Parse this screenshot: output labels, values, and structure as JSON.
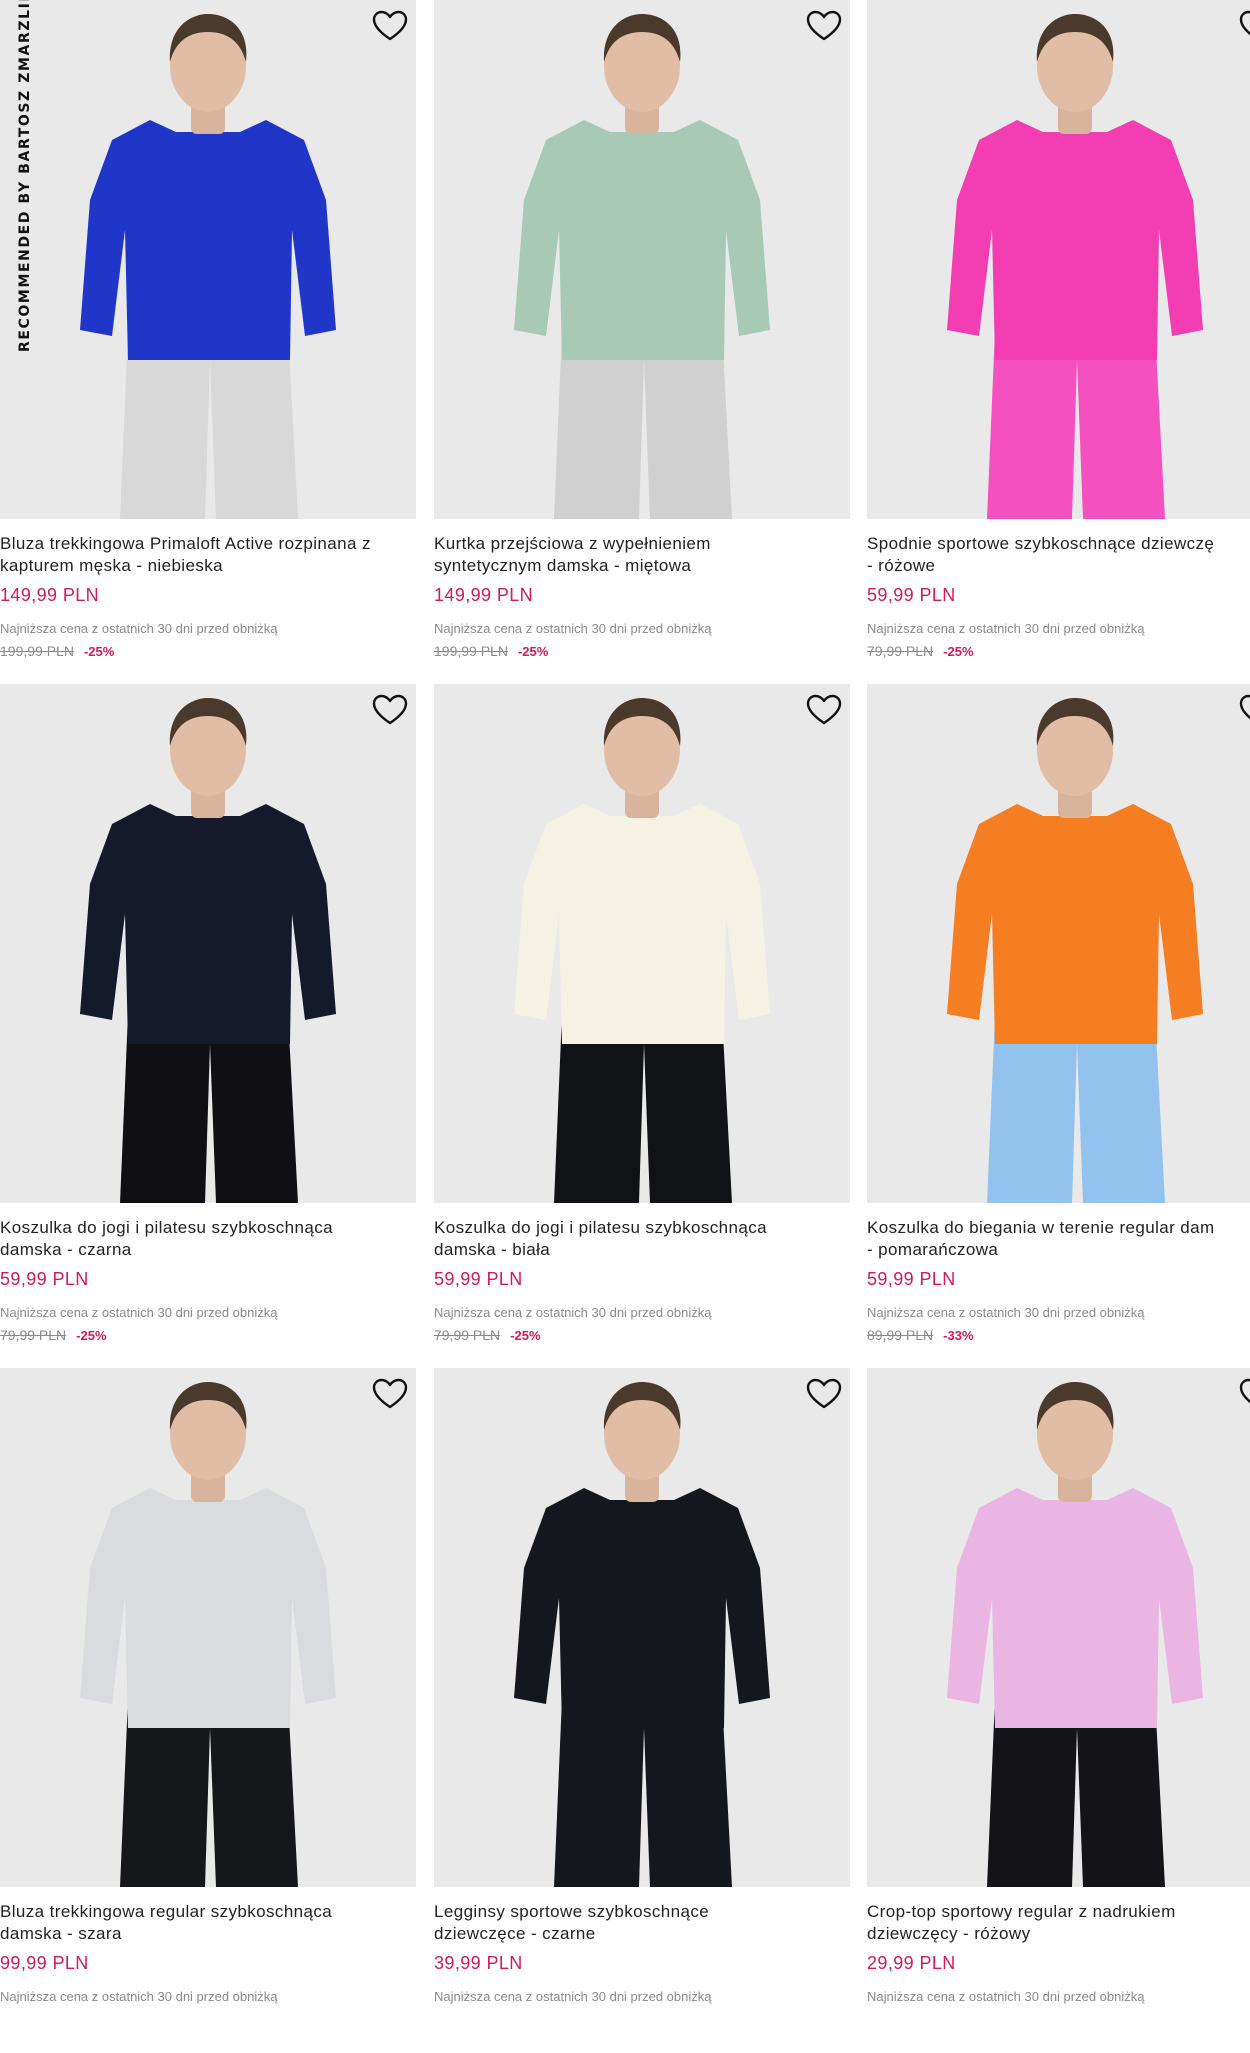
{
  "side_label": "RECOMMENDED BY BARTOSZ ZMARZLIK",
  "colors": {
    "accent": "#d6185c",
    "muted": "#8a8a8a",
    "image_bg": "#e9e9e9"
  },
  "icons": {
    "wishlist": "heart-outline-icon"
  },
  "products": [
    {
      "name_lines": [
        "Bluza trekkingowa Primaloft Active rozpinana z",
        "kapturem męska - niebieska"
      ],
      "price": "149,99 PLN",
      "lowest_label": "Najniższa cena z ostatnich 30 dni przed obniżką",
      "old_price": "199,99 PLN",
      "discount": "-25%",
      "garment_color": "#1f36c9",
      "bottom_color": "#d8d8d8"
    },
    {
      "name_lines": [
        "Kurtka przejściowa z wypełnieniem",
        "syntetycznym damska - miętowa"
      ],
      "price": "149,99 PLN",
      "lowest_label": "Najniższa cena z ostatnich 30 dni przed obniżką",
      "old_price": "199,99 PLN",
      "discount": "-25%",
      "garment_color": "#a7c9b5",
      "bottom_color": "#d0d0d0"
    },
    {
      "name_lines": [
        "Spodnie sportowe szybkoschnące dziewczę",
        "- różowe"
      ],
      "price": "59,99 PLN",
      "lowest_label": "Najniższa cena z ostatnich 30 dni przed obniżką",
      "old_price": "79,99 PLN",
      "discount": "-25%",
      "garment_color": "#f23db3",
      "bottom_color": "#f550bf"
    },
    {
      "name_lines": [
        "Koszulka do jogi i pilatesu szybkoschnąca",
        "damska - czarna"
      ],
      "price": "59,99 PLN",
      "lowest_label": "Najniższa cena z ostatnich 30 dni przed obniżką",
      "old_price": "79,99 PLN",
      "discount": "-25%",
      "garment_color": "#141a2b",
      "bottom_color": "#0f0f14"
    },
    {
      "name_lines": [
        "Koszulka do jogi i pilatesu szybkoschnąca",
        "damska - biała"
      ],
      "price": "59,99 PLN",
      "lowest_label": "Najniższa cena z ostatnich 30 dni przed obniżką",
      "old_price": "79,99 PLN",
      "discount": "-25%",
      "garment_color": "#f6f2e3",
      "bottom_color": "#111216"
    },
    {
      "name_lines": [
        "Koszulka do biegania w terenie regular dam",
        "- pomarańczowa"
      ],
      "price": "59,99 PLN",
      "lowest_label": "Najniższa cena z ostatnich 30 dni przed obniżką",
      "old_price": "89,99 PLN",
      "discount": "-33%",
      "garment_color": "#f57d22",
      "bottom_color": "#94c2ef"
    },
    {
      "name_lines": [
        "Bluza trekkingowa regular szybkoschnąca",
        "damska - szara"
      ],
      "price": "99,99 PLN",
      "lowest_label": "Najniższa cena z ostatnich 30 dni przed obniżką",
      "old_price": "",
      "discount": "",
      "garment_color": "#d9dbdf",
      "bottom_color": "#16171b"
    },
    {
      "name_lines": [
        "Legginsy sportowe szybkoschnące",
        "dziewczęce - czarne"
      ],
      "price": "39,99 PLN",
      "lowest_label": "Najniższa cena z ostatnich 30 dni przed obniżką",
      "old_price": "",
      "discount": "",
      "garment_color": "#15171f",
      "bottom_color": "#15171f"
    },
    {
      "name_lines": [
        "Crop-top sportowy regular z nadrukiem",
        "dziewczęcy - różowy"
      ],
      "price": "29,99 PLN",
      "lowest_label": "Najniższa cena z ostatnich 30 dni przed obniżką",
      "old_price": "",
      "discount": "",
      "garment_color": "#eab4e3",
      "bottom_color": "#141418"
    }
  ]
}
